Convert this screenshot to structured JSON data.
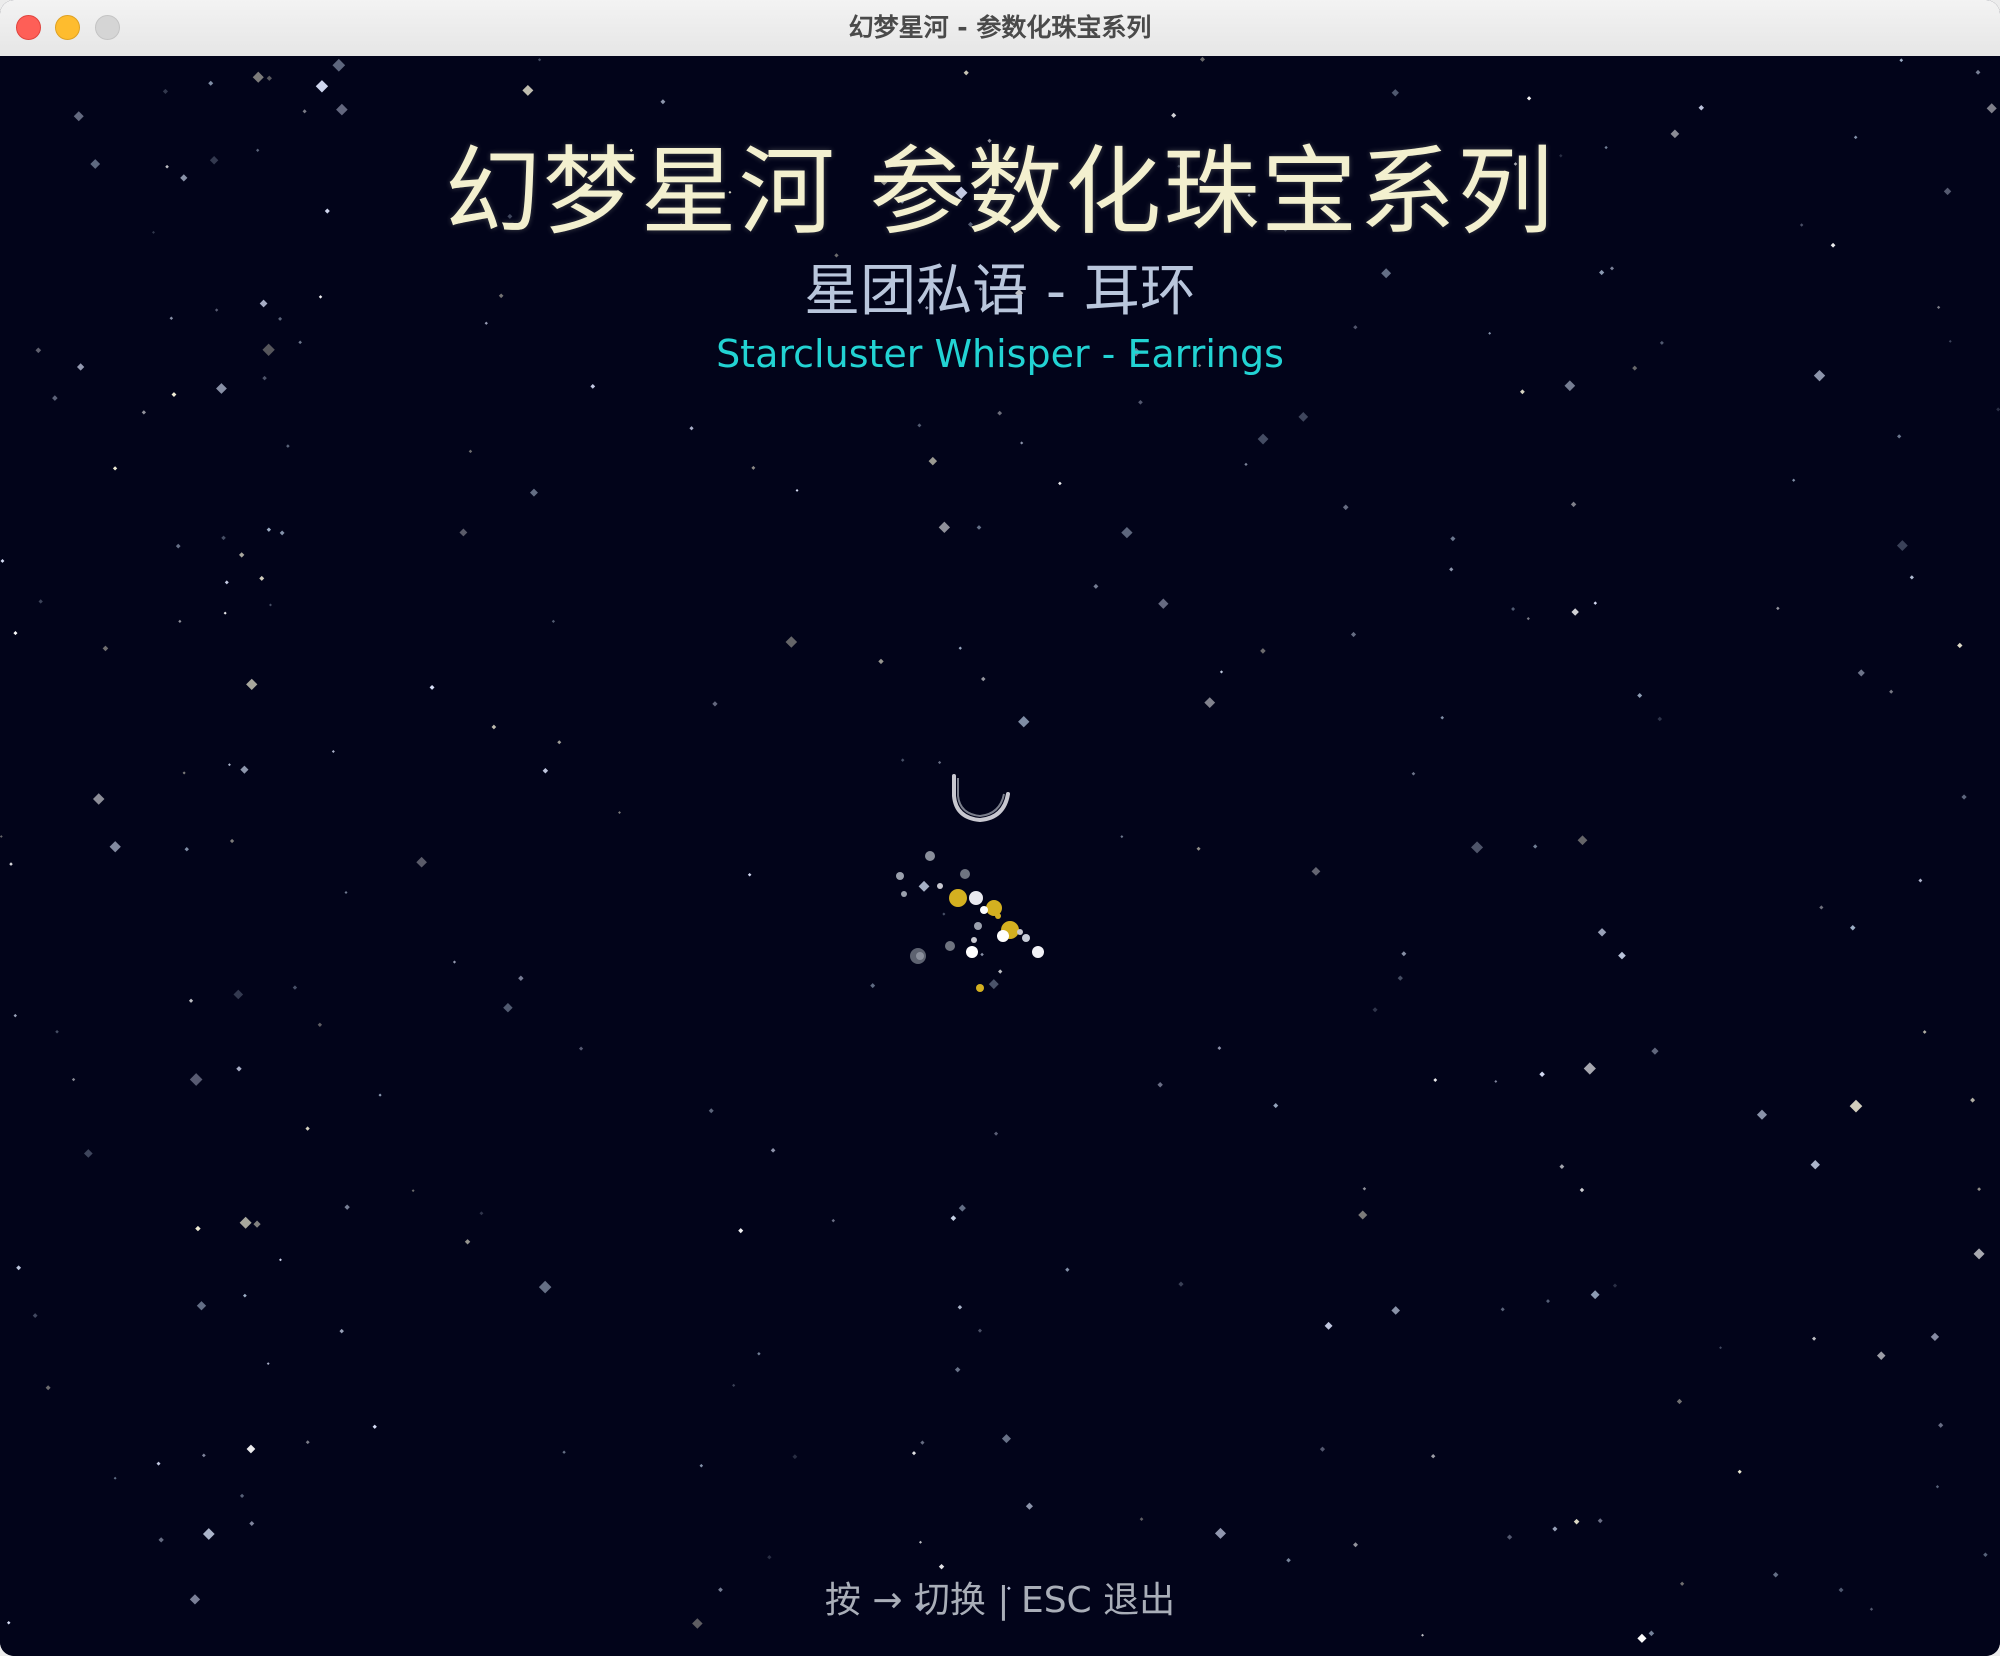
{
  "window": {
    "title": "幻梦星河 - 参数化珠宝系列",
    "controls": [
      "close",
      "minimize",
      "maximize"
    ]
  },
  "scene": {
    "background_color": "#02041a",
    "main_title": "幻梦星河 参数化珠宝系列",
    "subtitle_cn": "星团私语 - 耳环",
    "subtitle_en": "Starcluster Whisper - Earrings",
    "hint": "按 → 切换 | ESC 退出"
  },
  "colors": {
    "title": "#f3f0cf",
    "subtitle_cn": "#b9c6dc",
    "subtitle_en": "#22d3d3",
    "hint": "#a9aeb8",
    "gold": "#d4b020",
    "silver": "#c8c8d0"
  }
}
